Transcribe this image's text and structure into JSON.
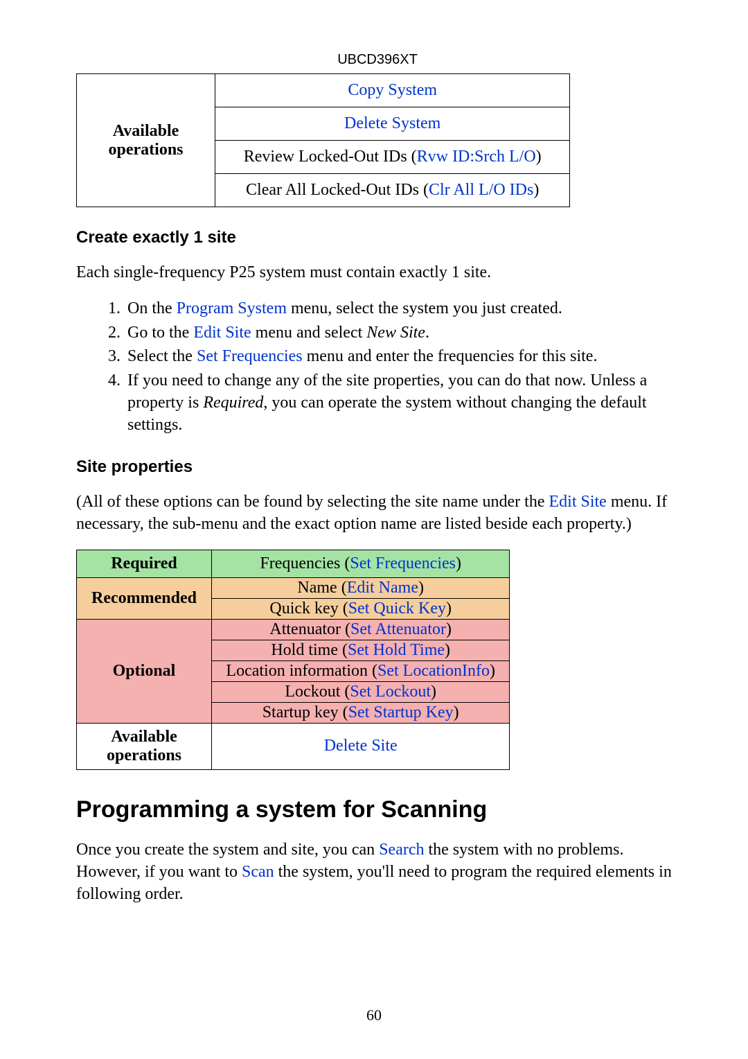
{
  "header": "UBCD396XT",
  "pageNumber": "60",
  "table1": {
    "rowLabel": "Available operations",
    "rows": [
      {
        "prefix": "",
        "link": "Copy System",
        "suffix": ""
      },
      {
        "prefix": "",
        "link": "Delete System",
        "suffix": ""
      },
      {
        "prefix": "Review Locked-Out IDs (",
        "link": "Rvw ID:Srch L/O",
        "suffix": ")"
      },
      {
        "prefix": "Clear All Locked-Out IDs (",
        "link": "Clr All L/O IDs",
        "suffix": ")"
      }
    ]
  },
  "section1": {
    "heading": "Create exactly 1 site",
    "intro": "Each single-frequency P25 system must contain exactly 1 site.",
    "steps": [
      {
        "pre": "On the ",
        "link": "Program System",
        "post": " menu, select the system you just created."
      },
      {
        "pre": "Go to the ",
        "link": "Edit Site",
        "post": " menu and select ",
        "em": "New Site",
        "tail": "."
      },
      {
        "pre": "Select the ",
        "link": "Set Frequencies",
        "post": " menu and enter the frequencies for this site."
      },
      {
        "pre": "If you need to change any of the site properties, you can do that now. Unless a property is ",
        "em": "Required",
        "post": ", you can operate the system without changing the default settings."
      }
    ]
  },
  "section2": {
    "heading": "Site properties",
    "introPre": "(All of these options can be found by selecting the site name under the ",
    "introLink": "Edit Site",
    "introPost": " menu. If necessary, the sub-menu and the exact option name are listed beside each property.)"
  },
  "table2": {
    "required": {
      "label": "Required",
      "rows": [
        {
          "pre": "Frequencies (",
          "link": "Set Frequencies",
          "post": ")"
        }
      ]
    },
    "recommended": {
      "label": "Recommended",
      "rows": [
        {
          "pre": "Name (",
          "link": "Edit Name",
          "post": ")"
        },
        {
          "pre": "Quick key (",
          "link": "Set Quick Key",
          "post": ")"
        }
      ]
    },
    "optional": {
      "label": "Optional",
      "rows": [
        {
          "pre": "Attenuator (",
          "link": "Set Attenuator",
          "post": ")"
        },
        {
          "pre": "Hold time (",
          "link": "Set Hold Time",
          "post": ")"
        },
        {
          "pre": "Location information (",
          "link": "Set LocationInfo",
          "post": ")"
        },
        {
          "pre": "Lockout (",
          "link": "Set Lockout",
          "post": ")"
        },
        {
          "pre": "Startup key (",
          "link": "Set Startup Key",
          "post": ")"
        }
      ]
    },
    "available": {
      "label": "Available operations",
      "rows": [
        {
          "pre": "",
          "link": "Delete Site",
          "post": ""
        }
      ]
    }
  },
  "section3": {
    "heading": "Programming a system for Scanning",
    "p1a": "Once you create the system and site, you can ",
    "p1link1": "Search",
    "p1b": " the system with no problems. However, if you want to ",
    "p1link2": "Scan",
    "p1c": " the system, you'll need to program the required elements in following order."
  }
}
